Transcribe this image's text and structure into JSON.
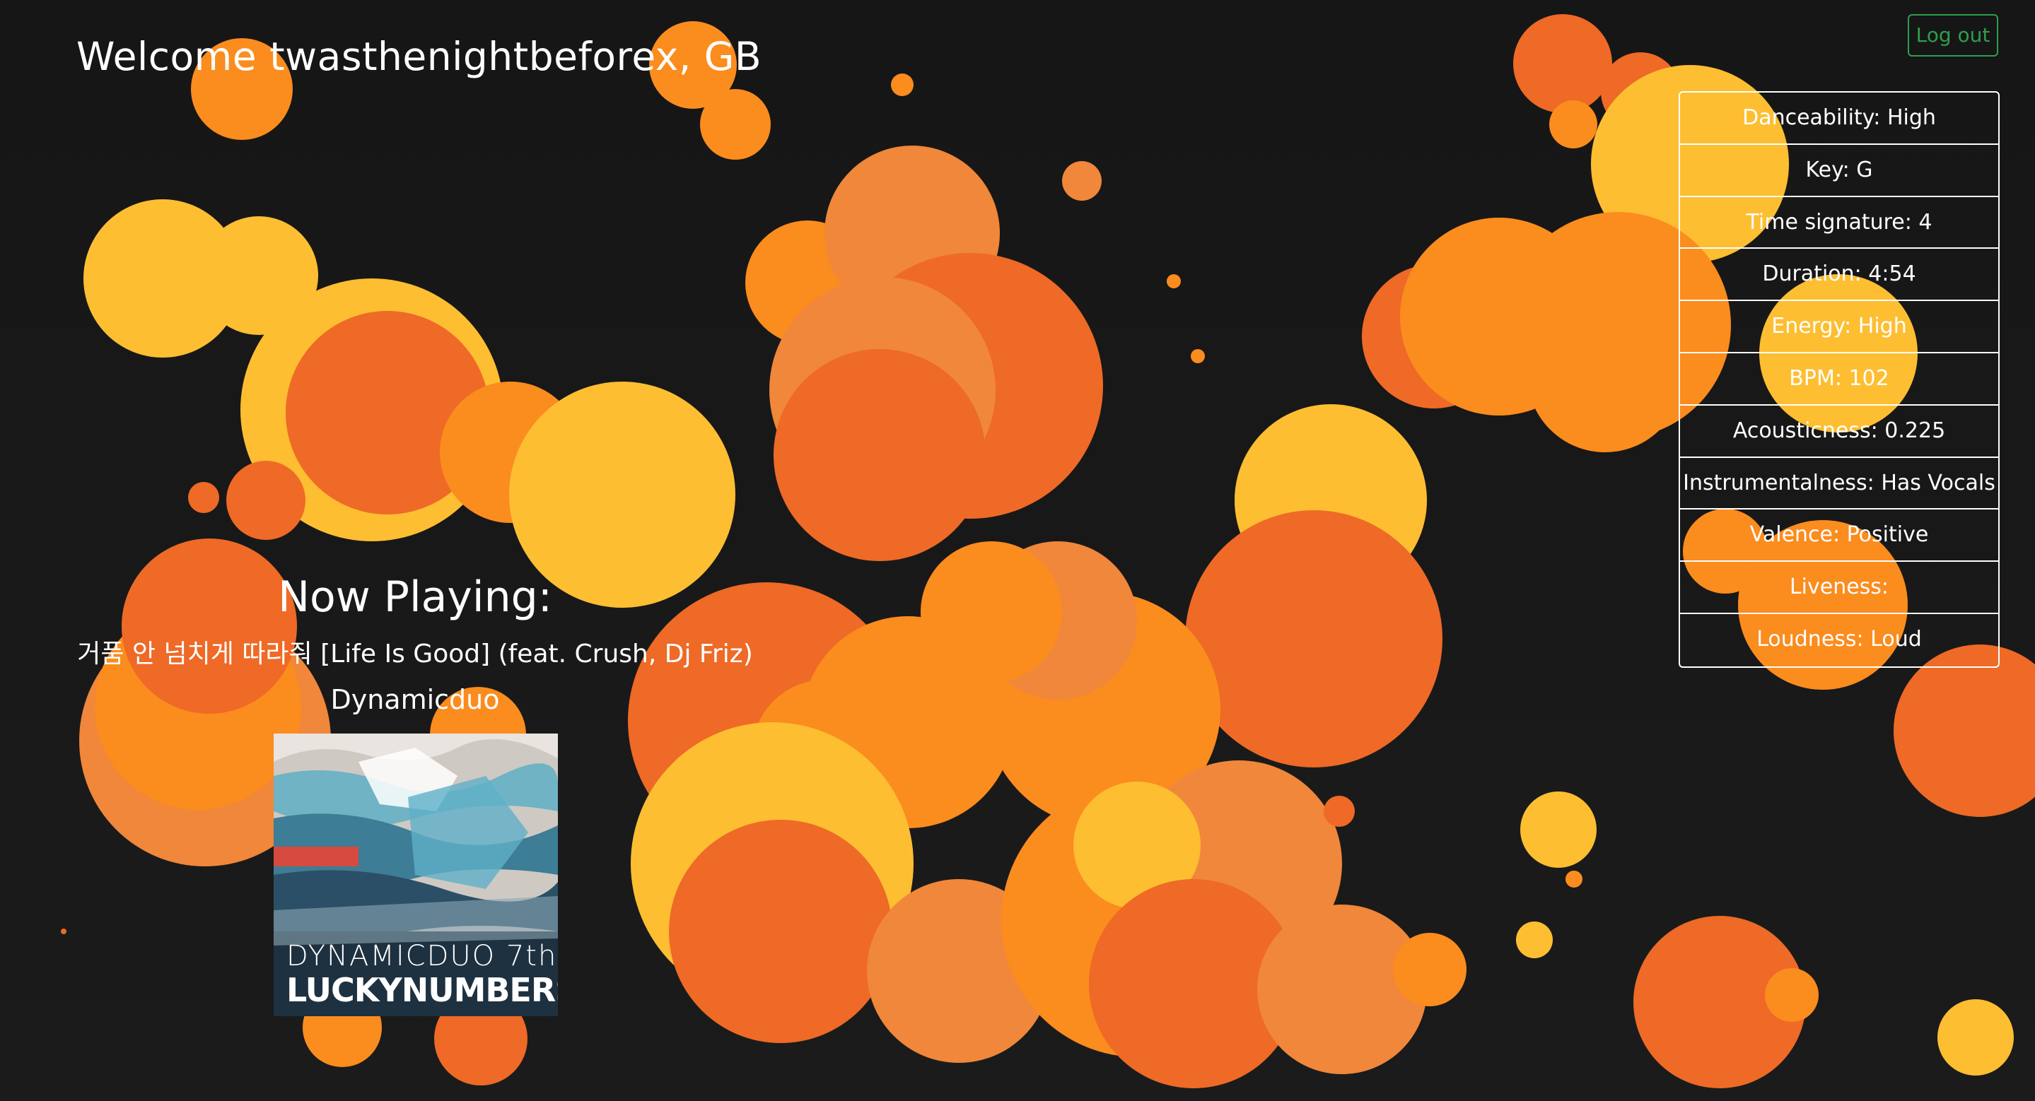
{
  "header": {
    "welcome_text": "Welcome twasthenightbeforex, GB",
    "logout_label": "Log out"
  },
  "colors": {
    "background": "#171717",
    "bubble_yellow": "#fdbe32",
    "bubble_orange": "#fb8c1e",
    "bubble_dark_orange": "#ee6a26",
    "bubble_mid_orange": "#f0873a",
    "logout_green": "#2e9e4f"
  },
  "features": [
    {
      "label": "Danceability: High"
    },
    {
      "label": "Key: G"
    },
    {
      "label": "Time signature: 4"
    },
    {
      "label": "Duration: 4:54"
    },
    {
      "label": "Energy: High"
    },
    {
      "label": "BPM: 102"
    },
    {
      "label": "Acousticness: 0.225"
    },
    {
      "label": "Instrumentalness: Has Vocals"
    },
    {
      "label": "Valence: Positive"
    },
    {
      "label": "Liveness:"
    },
    {
      "label": "Loudness: Loud"
    }
  ],
  "now_playing": {
    "heading": "Now Playing:",
    "track": "거품 안 넘치게 따라줘 [Life Is Good] (feat. Crush, Dj Friz)",
    "artist": "Dynamicduo",
    "album_art_line1": "DYNAMICDUO 7th",
    "album_art_line2": "LUCKYNUMBERS"
  }
}
